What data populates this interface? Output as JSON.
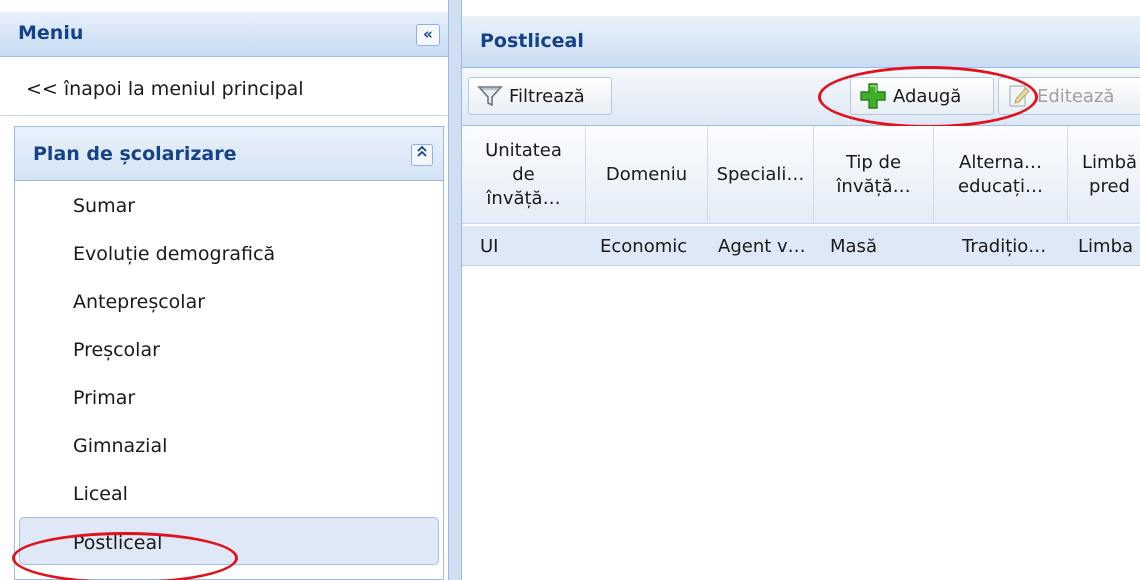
{
  "left": {
    "title": "Meniu",
    "collapse_glyph": "«",
    "back_link": "<< înapoi la meniul principal",
    "plan": {
      "title": "Plan de școlarizare",
      "collapse_glyph": "⌃",
      "items": [
        {
          "label": "Sumar"
        },
        {
          "label": "Evoluție demografică"
        },
        {
          "label": "Antepreșcolar"
        },
        {
          "label": "Preșcolar"
        },
        {
          "label": "Primar"
        },
        {
          "label": "Gimnazial"
        },
        {
          "label": "Liceal"
        },
        {
          "label": "Postliceal",
          "selected": true
        }
      ]
    }
  },
  "right": {
    "title": "Postliceal",
    "toolbar": {
      "filter_label": "Filtrează",
      "add_label": "Adaugă",
      "edit_label": "Editează"
    },
    "grid": {
      "headers": [
        "Unitatea\nde\nînvăță…",
        "Domeniu",
        "Speciali…",
        "Tip de\nînvăță…",
        "Alterna…\neducați…",
        "Limbă\npred"
      ],
      "rows": [
        [
          "UI",
          "Economic",
          "Agent v…",
          "Masă",
          "Tradițio…",
          "Limba"
        ]
      ]
    }
  },
  "colors": {
    "header_text": "#15428b",
    "annotation": "#e0121e",
    "selection": "#dfe8f6",
    "add_icon": "#3fae2a"
  },
  "icons": {
    "collapse_left": "double-chevron-left-icon",
    "collapse_up": "double-chevron-up-icon",
    "filter": "funnel-icon",
    "add": "green-plus-icon",
    "edit": "edit-document-icon"
  }
}
